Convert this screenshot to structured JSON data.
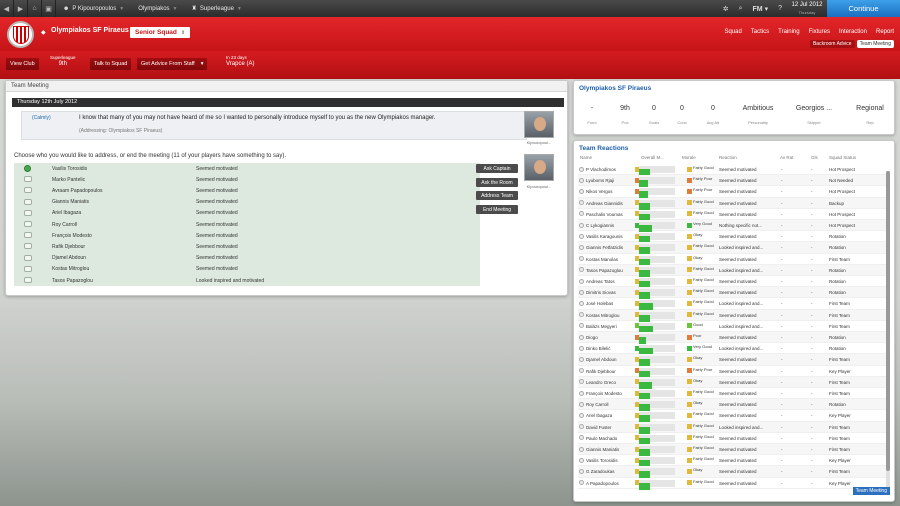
{
  "topbar": {
    "crumbs": [
      "P Kipouropoulos",
      "Olympiakos",
      "Superleague"
    ],
    "date": "12 Jul 2012",
    "day": "Thursday",
    "fm_label": "FM",
    "continue_label": "Continue"
  },
  "club": {
    "name": "Olympiakos SF Piraeus",
    "squad_button": "Senior Squad",
    "menu": [
      "Squad",
      "Tactics",
      "Training",
      "Fixtures",
      "Interaction",
      "Report"
    ],
    "subtabs": [
      "Backroom Advice",
      "Team Meeting"
    ]
  },
  "secondary": {
    "view_club": "View Club",
    "league_label": "Superleague",
    "league_pos": "9th",
    "talk_to_squad": "Talk to Squad",
    "get_advice": "Get Advice From Staff",
    "next_match_label": "In 23 days",
    "next_match": "Vrapce (A)"
  },
  "meeting": {
    "panel_title": "Team Meeting",
    "date": "Thursday 12th July 2012",
    "tone": "(Calmly)",
    "speech": "I know that many of you may not have heard of me so I wanted to personally introduce myself to you as the new Olympiakos manager.",
    "addressing": "(Addressing: Olympiakos SF Piraeus)",
    "choose_text": "Choose who you would like to address, or end the meeting (11 of your players have something to say).",
    "players": [
      {
        "name": "Vasilis Torosidis",
        "mood": "Seemed motivated"
      },
      {
        "name": "Marko Pantelic",
        "mood": "Seemed motivated"
      },
      {
        "name": "Avraam Papadopoulos",
        "mood": "Seemed motivated"
      },
      {
        "name": "Giannis Maniatis",
        "mood": "Seemed motivated"
      },
      {
        "name": "Ariel Ibagaza",
        "mood": "Seemed motivated"
      },
      {
        "name": "Roy Carroll",
        "mood": "Seemed motivated"
      },
      {
        "name": "François Modesto",
        "mood": "Seemed motivated"
      },
      {
        "name": "Rafik Djebbour",
        "mood": "Seemed motivated"
      },
      {
        "name": "Djamel Abdoun",
        "mood": "Seemed motivated"
      },
      {
        "name": "Kostas Mitroglou",
        "mood": "Seemed motivated"
      },
      {
        "name": "Tasos Papazoglou",
        "mood": "Looked inspired and motivated"
      }
    ],
    "actions": [
      "Ask Captain",
      "Ask the Room",
      "Address Team",
      "End Meeting"
    ],
    "portrait_label": "Kipouropoul..."
  },
  "club_panel": {
    "title": "Olympiakos SF Piraeus",
    "stats": [
      {
        "value": "-",
        "label": "Form"
      },
      {
        "value": "9th",
        "label": "Pos"
      },
      {
        "value": "0",
        "label": "Goals"
      },
      {
        "value": "0",
        "label": "Conc"
      },
      {
        "value": "0",
        "label": "Avg Att"
      },
      {
        "value": "Ambitious",
        "label": "Personality"
      },
      {
        "value": "Georgios ...",
        "label": "Skipper"
      },
      {
        "value": "Regional",
        "label": "Rep"
      }
    ]
  },
  "reactions": {
    "title": "Team Reactions",
    "headers": [
      "Name",
      "Overall M...",
      "Morale",
      "Reaction",
      "Av Rat",
      "Gls",
      "Squad Status"
    ],
    "rows": [
      {
        "name": "P Vlachodimos",
        "ov": 0.3,
        "morale": "Fairly Good",
        "mc": "#e0b83a",
        "reaction": "Seemed motivated",
        "rat": "-",
        "gls": "-",
        "status": "Hot Prospect"
      },
      {
        "name": "Lyuboms Rjaji",
        "ov": 0.25,
        "morale": "Fairly Poor",
        "mc": "#e07b3a",
        "reaction": "Seemed motivated",
        "rat": "-",
        "gls": "-",
        "status": "Not Needed"
      },
      {
        "name": "Nikos Vergos",
        "ov": 0.25,
        "morale": "Fairly Poor",
        "mc": "#e07b3a",
        "reaction": "Seemed motivated",
        "rat": "-",
        "gls": "-",
        "status": "Hot Prospect"
      },
      {
        "name": "Andreas Giannidis",
        "ov": 0.3,
        "morale": "Fairly Good",
        "mc": "#e0b83a",
        "reaction": "Seemed motivated",
        "rat": "-",
        "gls": "-",
        "status": "Backup"
      },
      {
        "name": "Paschalis Voumas",
        "ov": 0.3,
        "morale": "Fairly Good",
        "mc": "#e0b83a",
        "reaction": "Seemed motivated",
        "rat": "-",
        "gls": "-",
        "status": "Hot Prospect"
      },
      {
        "name": "C Lykogiannis",
        "ov": 0.35,
        "morale": "Very Good",
        "mc": "#3ab83f",
        "reaction": "Nothing specific not...",
        "rat": "-",
        "gls": "-",
        "status": "Hot Prospect"
      },
      {
        "name": "Vasilis Karagounis",
        "ov": 0.3,
        "morale": "Okay",
        "mc": "#e0b83a",
        "reaction": "Seemed motivated",
        "rat": "-",
        "gls": "-",
        "status": "Rotation"
      },
      {
        "name": "Giannis Fetfatzidis",
        "ov": 0.3,
        "morale": "Fairly Good",
        "mc": "#e0b83a",
        "reaction": "Looked inspired and...",
        "rat": "-",
        "gls": "-",
        "status": "Rotation"
      },
      {
        "name": "Kostas Manolas",
        "ov": 0.3,
        "morale": "Okay",
        "mc": "#e0b83a",
        "reaction": "Seemed motivated",
        "rat": "-",
        "gls": "-",
        "status": "First Team"
      },
      {
        "name": "Tasos Papazoglou",
        "ov": 0.3,
        "morale": "Fairly Good",
        "mc": "#e0b83a",
        "reaction": "Looked inspired and...",
        "rat": "-",
        "gls": "-",
        "status": "Rotation"
      },
      {
        "name": "Andreas Tatos",
        "ov": 0.3,
        "morale": "Fairly Good",
        "mc": "#e0b83a",
        "reaction": "Seemed motivated",
        "rat": "-",
        "gls": "-",
        "status": "Rotation"
      },
      {
        "name": "Dimitris Siovas",
        "ov": 0.3,
        "morale": "Fairly Good",
        "mc": "#e0b83a",
        "reaction": "Seemed motivated",
        "rat": "-",
        "gls": "-",
        "status": "Rotation"
      },
      {
        "name": "José Holebas",
        "ov": 0.4,
        "morale": "Fairly Good",
        "mc": "#e0b83a",
        "reaction": "Looked inspired and...",
        "rat": "-",
        "gls": "-",
        "status": "First Team"
      },
      {
        "name": "Kostas Mitroglou",
        "ov": 0.3,
        "morale": "Fairly Good",
        "mc": "#e0b83a",
        "reaction": "Seemed motivated",
        "rat": "-",
        "gls": "-",
        "status": "First Team"
      },
      {
        "name": "Balázs Megyeri",
        "ov": 0.4,
        "morale": "Good",
        "mc": "#6bc43a",
        "reaction": "Looked inspired and...",
        "rat": "-",
        "gls": "-",
        "status": "First Team"
      },
      {
        "name": "Diogo",
        "ov": 0.2,
        "morale": "Poor",
        "mc": "#e07b3a",
        "reaction": "Seemed motivated",
        "rat": "-",
        "gls": "-",
        "status": "Rotation"
      },
      {
        "name": "Dinko Bilelić",
        "ov": 0.4,
        "morale": "Very Good",
        "mc": "#3ab83f",
        "reaction": "Looked inspired and...",
        "rat": "-",
        "gls": "-",
        "status": "Rotation"
      },
      {
        "name": "Djamel Abdoun",
        "ov": 0.3,
        "morale": "Okay",
        "mc": "#e0b83a",
        "reaction": "Seemed motivated",
        "rat": "-",
        "gls": "-",
        "status": "First Team"
      },
      {
        "name": "Rafik Djebbour",
        "ov": 0.3,
        "morale": "Fairly Poor",
        "mc": "#e07b3a",
        "reaction": "Seemed motivated",
        "rat": "-",
        "gls": "-",
        "status": "Key Player"
      },
      {
        "name": "Leandro Greco",
        "ov": 0.35,
        "morale": "Okay",
        "mc": "#e0b83a",
        "reaction": "Seemed motivated",
        "rat": "-",
        "gls": "-",
        "status": "First Team"
      },
      {
        "name": "François Modesto",
        "ov": 0.3,
        "morale": "Fairly Good",
        "mc": "#e0b83a",
        "reaction": "Seemed motivated",
        "rat": "-",
        "gls": "-",
        "status": "First Team"
      },
      {
        "name": "Roy Carroll",
        "ov": 0.3,
        "morale": "Okay",
        "mc": "#e0b83a",
        "reaction": "Seemed motivated",
        "rat": "-",
        "gls": "-",
        "status": "Rotation"
      },
      {
        "name": "Ariel Ibagaza",
        "ov": 0.3,
        "morale": "Fairly Good",
        "mc": "#e0b83a",
        "reaction": "Seemed motivated",
        "rat": "-",
        "gls": "-",
        "status": "Key Player"
      },
      {
        "name": "David Fuster",
        "ov": 0.3,
        "morale": "Fairly Good",
        "mc": "#e0b83a",
        "reaction": "Looked inspired and...",
        "rat": "-",
        "gls": "-",
        "status": "First Team"
      },
      {
        "name": "Paulo Machado",
        "ov": 0.3,
        "morale": "Fairly Good",
        "mc": "#e0b83a",
        "reaction": "Seemed motivated",
        "rat": "-",
        "gls": "-",
        "status": "First Team"
      },
      {
        "name": "Giannis Maniatis",
        "ov": 0.3,
        "morale": "Fairly Good",
        "mc": "#e0b83a",
        "reaction": "Seemed motivated",
        "rat": "-",
        "gls": "-",
        "status": "First Team"
      },
      {
        "name": "Vasilis Torosidis",
        "ov": 0.3,
        "morale": "Fairly Good",
        "mc": "#e0b83a",
        "reaction": "Seemed motivated",
        "rat": "-",
        "gls": "-",
        "status": "Key Player"
      },
      {
        "name": "G Zaradoukas",
        "ov": 0.3,
        "morale": "Okay",
        "mc": "#e0b83a",
        "reaction": "Seemed motivated",
        "rat": "-",
        "gls": "-",
        "status": "First Team"
      },
      {
        "name": "A Papadopoulos",
        "ov": 0.3,
        "morale": "Fairly Good",
        "mc": "#e0b83a",
        "reaction": "Seemed motivated",
        "rat": "-",
        "gls": "-",
        "status": "Key Player"
      }
    ],
    "corner_label": "Team Meeting"
  }
}
